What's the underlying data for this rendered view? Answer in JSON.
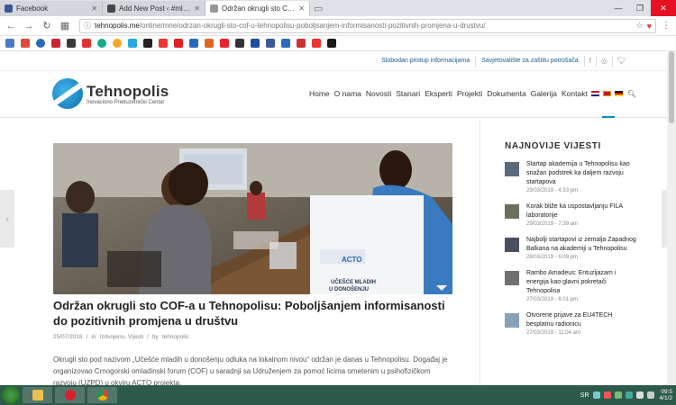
{
  "browser": {
    "tabs": [
      {
        "label": "Facebook",
        "color": "#3b5998",
        "active": false
      },
      {
        "label": "Add New Post ‹ #mladiN",
        "color": "#464646",
        "active": false
      },
      {
        "label": "Održan okrugli sto COF-a",
        "color": "#888888",
        "active": true
      }
    ],
    "address_domain": "tehnopolis.me",
    "address_path": "/online/mne/odrzan-okrugli-sto-cof-u-tehnopolisu-poboljsanjem-informisanosti-pozitivnih-promjena-u-drustvu/"
  },
  "site": {
    "topbar_links": [
      "Slobodan pristup informacijama",
      "Savjetovalište za zaštitu potrošača"
    ],
    "logo_name": "Tehnopolis",
    "logo_sub": "Inovaciono Preduzetnički Centar",
    "nav": [
      "Home",
      "O nama",
      "Novosti",
      "Stanari",
      "Eksperti",
      "Projekti",
      "Dokumenta",
      "Galerija",
      "Kontakt"
    ]
  },
  "article": {
    "title": "Održan okrugli sto COF-a u Tehnopolisu: Poboljšanjem informisanosti do pozitivnih promjena u društvu",
    "date": "25/07/2018",
    "category_prefix": "in",
    "categories": "Izdvojeno, Vijesti",
    "author_prefix": "by",
    "author": "tehnopolis",
    "body": "Okrugli sto pod nazivom „Učešće mladih u donošenju odluka na lokalnom nivou“ održan je danas u Tehnopolisu. Događaj je organizovao Crnogorski omladinski forum (COF) u saradnji sa Udruženjem za pomoć licima ometenim u psihofizičkom razvoju (UZPD) u okviru ACTO projekta."
  },
  "sidebar": {
    "heading": "NAJNOVIJE VIJESTI",
    "items": [
      {
        "title": "Startap akademija u Tehnopolisu kao snažan podstrek ka daljem razvoju startapova",
        "date": "29/03/2019 - 4:33 pm"
      },
      {
        "title": "Korak bliže ka uspostavljanju FILA laboratorije",
        "date": "29/03/2019 - 7:39 am"
      },
      {
        "title": "Najbolji startapovi iz zemalja Zapadnog Balkana na akademiji u Tehnopolisu",
        "date": "28/03/2019 - 6:09 pm"
      },
      {
        "title": "Rambo Amadeus: Entuzijazam i energija kao glavni pokretači Tehnopolisa",
        "date": "27/03/2019 - 6:01 pm"
      },
      {
        "title": "Otvorene prijave za EU4TECH besplatnu radionicu",
        "date": "27/03/2019 - 11:04 am"
      }
    ]
  },
  "taskbar": {
    "lang": "SR",
    "time": "09:5",
    "date": "4/1/2"
  },
  "colors": {
    "accent": "#0a8ac8",
    "link": "#1a5c8c",
    "taskbar": "#2d5a4a"
  }
}
